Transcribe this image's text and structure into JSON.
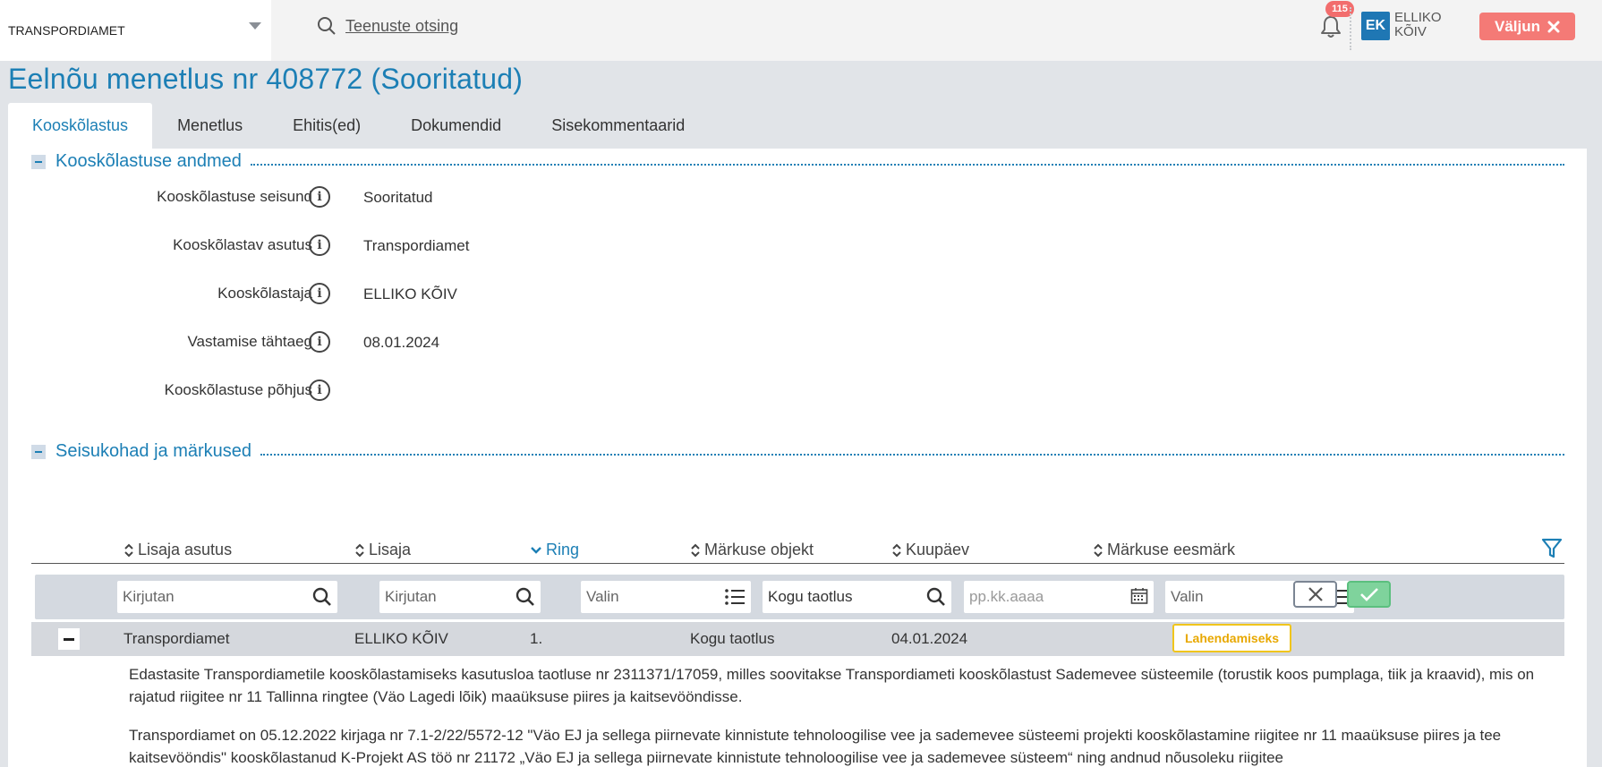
{
  "topbar": {
    "organization": "TRANSPORDIAMET",
    "search_label": "Teenuste otsing",
    "notifications_count": "115",
    "user_initials": "EK",
    "user_name": "ELLIKO KÕIV",
    "logout_label": "Väljun"
  },
  "page": {
    "title": "Eelnõu menetlus nr 408772 (Sooritatud)"
  },
  "tabs": [
    {
      "label": "Kooskõlastus",
      "active": true
    },
    {
      "label": "Menetlus",
      "active": false
    },
    {
      "label": "Ehitis(ed)",
      "active": false
    },
    {
      "label": "Dokumendid",
      "active": false
    },
    {
      "label": "Sisekommentaarid",
      "active": false
    }
  ],
  "section1": {
    "title": "Kooskõlastuse andmed",
    "fields": [
      {
        "label": "Kooskõlastuse seisund",
        "value": "Sooritatud"
      },
      {
        "label": "Kooskõlastav asutus",
        "value": "Transpordiamet"
      },
      {
        "label": "Kooskõlastaja",
        "value": "ELLIKO KÕIV"
      },
      {
        "label": "Vastamise tähtaeg",
        "value": "08.01.2024"
      },
      {
        "label": "Kooskõlastuse põhjus",
        "value": ""
      }
    ]
  },
  "section2": {
    "title": "Seisukohad ja märkused",
    "columns": [
      "Lisaja asutus",
      "Lisaja",
      "Ring",
      "Märkuse objekt",
      "Kuupäev",
      "Märkuse eesmärk"
    ],
    "filters": {
      "lisaja_asutus": "Kirjutan",
      "lisaja": "Kirjutan",
      "ring": "Valin",
      "objekt": "Kogu taotlus",
      "kuupaev": "pp.kk.aaaa",
      "eesmark": "Valin"
    },
    "row": {
      "asutus": "Transpordiamet",
      "lisaja": "ELLIKO KÕIV",
      "ring": "1.",
      "objekt": "Kogu taotlus",
      "kuupaev": "04.01.2024",
      "eesmark": "Lahendamiseks"
    },
    "comment_p1": "Edastasite Transpordiametile kooskõlastamiseks kasutusloa taotluse nr 2311371/17059, milles soovitakse Transpordiameti kooskõlastust Sademevee süsteemile (torustik koos pumplaga, tiik ja kraavid), mis on rajatud riigitee nr 11 Tallinna ringtee (Väo Lagedi lõik) maaüksuse piires ja kaitsevööndisse.",
    "comment_p2": "Transpordiamet on 05.12.2022 kirjaga nr 7.1-2/22/5572-12 \"Väo EJ ja sellega piirnevate kinnistute tehnoloogilise vee ja sademevee süsteemi projekti kooskõlastamine riigitee nr 11 maaüksuse piires ja tee kaitsevööndis\" kooskõlastanud K-Projekt AS töö nr 21172 „Väo EJ ja sellega piirnevate kinnistute tehnoloogilise vee ja sademevee süsteem“ ning andnud nõusoleku riigitee"
  },
  "colors": {
    "accent": "#1c7fb5",
    "logout": "#f47a76",
    "badge": "#f0c51c",
    "apply": "#7fd39c"
  },
  "icons": [
    "chevron-down-icon",
    "search-icon",
    "bell-icon",
    "close-icon",
    "info-icon",
    "sort-icon",
    "funnel-icon",
    "list-icon",
    "calendar-icon",
    "check-icon",
    "collapse-icon"
  ]
}
